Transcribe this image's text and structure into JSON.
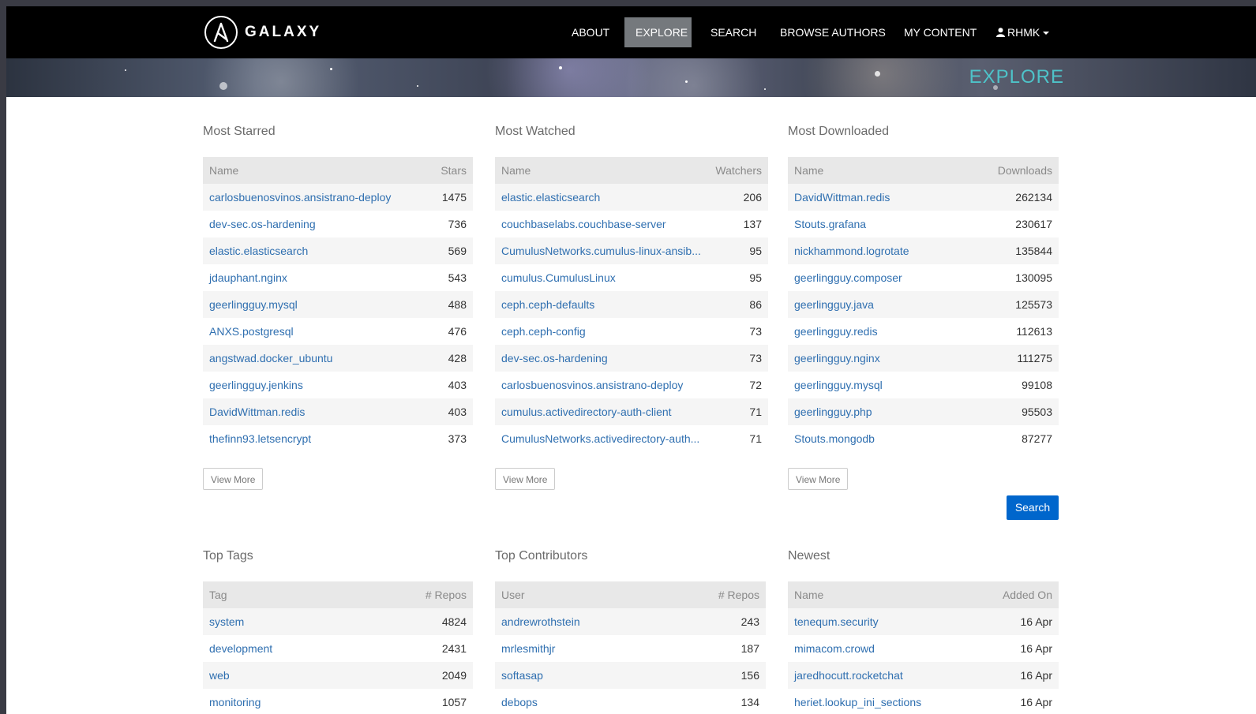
{
  "nav": {
    "brand": "GALAXY",
    "items": [
      "ABOUT",
      "EXPLORE",
      "SEARCH",
      "BROWSE AUTHORS",
      "MY CONTENT"
    ],
    "user": "RHMK",
    "active": "EXPLORE"
  },
  "banner": {
    "title": "EXPLORE"
  },
  "panels": {
    "most_starred": {
      "title": "Most Starred",
      "headers": [
        "Name",
        "Stars"
      ],
      "rows": [
        [
          "carlosbuenosvinos.ansistrano-deploy",
          "1475"
        ],
        [
          "dev-sec.os-hardening",
          "736"
        ],
        [
          "elastic.elasticsearch",
          "569"
        ],
        [
          "jdauphant.nginx",
          "543"
        ],
        [
          "geerlingguy.mysql",
          "488"
        ],
        [
          "ANXS.postgresql",
          "476"
        ],
        [
          "angstwad.docker_ubuntu",
          "428"
        ],
        [
          "geerlingguy.jenkins",
          "403"
        ],
        [
          "DavidWittman.redis",
          "403"
        ],
        [
          "thefinn93.letsencrypt",
          "373"
        ]
      ],
      "more": "View More"
    },
    "most_watched": {
      "title": "Most Watched",
      "headers": [
        "Name",
        "Watchers"
      ],
      "rows": [
        [
          "elastic.elasticsearch",
          "206"
        ],
        [
          "couchbaselabs.couchbase-server",
          "137"
        ],
        [
          "CumulusNetworks.cumulus-linux-ansib...",
          "95"
        ],
        [
          "cumulus.CumulusLinux",
          "95"
        ],
        [
          "ceph.ceph-defaults",
          "86"
        ],
        [
          "ceph.ceph-config",
          "73"
        ],
        [
          "dev-sec.os-hardening",
          "73"
        ],
        [
          "carlosbuenosvinos.ansistrano-deploy",
          "72"
        ],
        [
          "cumulus.activedirectory-auth-client",
          "71"
        ],
        [
          "CumulusNetworks.activedirectory-auth...",
          "71"
        ]
      ],
      "more": "View More"
    },
    "most_downloaded": {
      "title": "Most Downloaded",
      "headers": [
        "Name",
        "Downloads"
      ],
      "rows": [
        [
          "DavidWittman.redis",
          "262134"
        ],
        [
          "Stouts.grafana",
          "230617"
        ],
        [
          "nickhammond.logrotate",
          "135844"
        ],
        [
          "geerlingguy.composer",
          "130095"
        ],
        [
          "geerlingguy.java",
          "125573"
        ],
        [
          "geerlingguy.redis",
          "112613"
        ],
        [
          "geerlingguy.nginx",
          "111275"
        ],
        [
          "geerlingguy.mysql",
          "99108"
        ],
        [
          "geerlingguy.php",
          "95503"
        ],
        [
          "Stouts.mongodb",
          "87277"
        ]
      ],
      "more": "View More"
    },
    "top_tags": {
      "title": "Top Tags",
      "headers": [
        "Tag",
        "# Repos"
      ],
      "rows": [
        [
          "system",
          "4824"
        ],
        [
          "development",
          "2431"
        ],
        [
          "web",
          "2049"
        ],
        [
          "monitoring",
          "1057"
        ]
      ]
    },
    "top_contributors": {
      "title": "Top Contributors",
      "headers": [
        "User",
        "# Repos"
      ],
      "rows": [
        [
          "andrewrothstein",
          "243"
        ],
        [
          "mrlesmithjr",
          "187"
        ],
        [
          "softasap",
          "156"
        ],
        [
          "debops",
          "134"
        ]
      ]
    },
    "newest": {
      "title": "Newest",
      "headers": [
        "Name",
        "Added On"
      ],
      "rows": [
        [
          "tenequm.security",
          "16 Apr"
        ],
        [
          "mimacom.crowd",
          "16 Apr"
        ],
        [
          "jaredhocutt.rocketchat",
          "16 Apr"
        ],
        [
          "heriet.lookup_ini_sections",
          "16 Apr"
        ]
      ]
    }
  },
  "search_button": "Search"
}
